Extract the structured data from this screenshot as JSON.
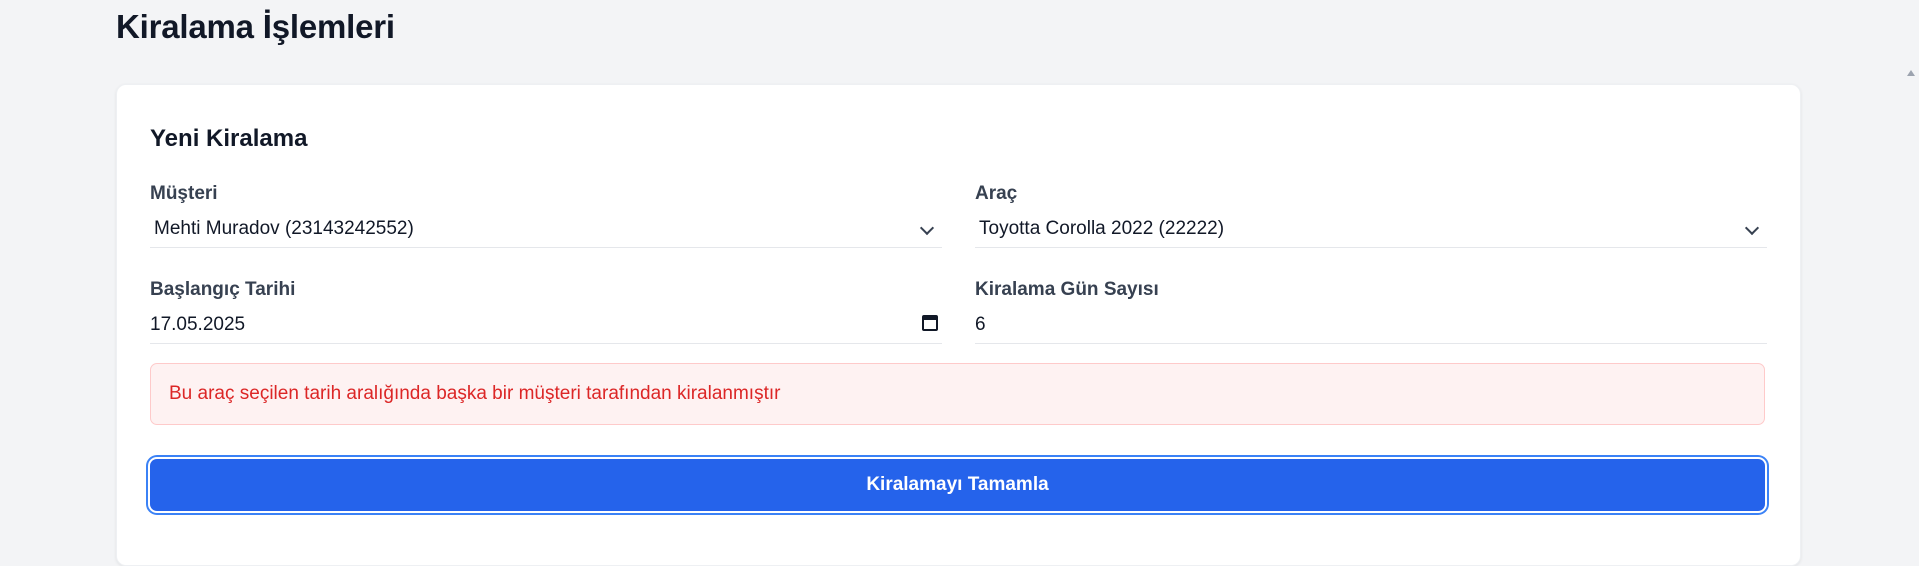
{
  "page": {
    "title": "Kiralama İşlemleri"
  },
  "form": {
    "title": "Yeni Kiralama",
    "customer": {
      "label": "Müşteri",
      "value": "Mehti Muradov (23143242552)"
    },
    "vehicle": {
      "label": "Araç",
      "value": "Toyotta Corolla 2022 (22222)"
    },
    "start_date": {
      "label": "Başlangıç Tarihi",
      "value": "17.05.2025"
    },
    "days": {
      "label": "Kiralama Gün Sayısı",
      "value": "6"
    },
    "error": "Bu araç seçilen tarih aralığında başka bir müşteri tarafından kiralanmıştır",
    "submit_label": "Kiralamayı Tamamla"
  },
  "colors": {
    "primary": "#2563eb",
    "error_text": "#dc2626",
    "error_bg": "#fef2f2",
    "page_bg": "#f3f4f6"
  },
  "icons": [
    "chevron-down-icon",
    "calendar-icon"
  ]
}
